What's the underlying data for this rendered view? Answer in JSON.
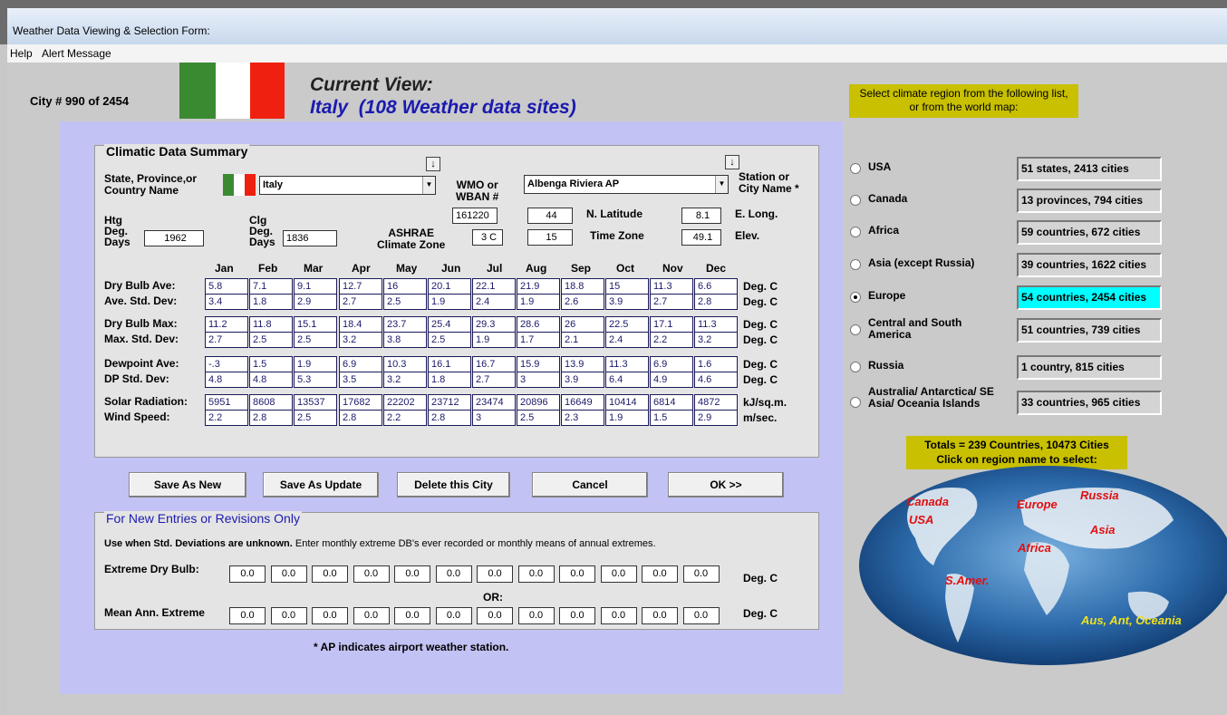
{
  "window": {
    "title": "Weather Data Viewing & Selection Form:"
  },
  "menu": {
    "help": "Help",
    "alert": "Alert Message"
  },
  "header": {
    "city_counter": "City # 990 of 2454",
    "current_view_label": "Current View:",
    "current_view_value": "Italy  (108 Weather data sites)"
  },
  "climatic": {
    "group_title": "Climatic Data Summary",
    "state_label_1": "State, Province,or",
    "state_label_2": "Country Name",
    "country_value": "Italy",
    "wmo_label_1": "WMO or",
    "wmo_label_2": "WBAN #",
    "station_value": "Albenga Riviera AP",
    "station_label_1": "Station or",
    "station_label_2": "City Name *",
    "wmo_value": "161220",
    "latitude_value": "44",
    "latitude_label": "N. Latitude",
    "longitude_value": "8.1",
    "longitude_label": "E. Long.",
    "htg_label_1": "Htg",
    "htg_label_2": "Deg.",
    "htg_label_3": "Days",
    "htg_value": "1962",
    "clg_label_1": "Clg",
    "clg_label_2": "Deg.",
    "clg_label_3": "Days",
    "clg_value": "1836",
    "ashrae_label_1": "ASHRAE",
    "ashrae_label_2": "Climate Zone",
    "ashrae_value": "3 C",
    "timezone_value": "15",
    "timezone_label": "Time Zone",
    "elev_value": "49.1",
    "elev_label": "Elev."
  },
  "months": [
    "Jan",
    "Feb",
    "Mar",
    "Apr",
    "May",
    "Jun",
    "Jul",
    "Aug",
    "Sep",
    "Oct",
    "Nov",
    "Dec"
  ],
  "rows": [
    {
      "label": "Dry Bulb Ave:",
      "unit": "Deg. C",
      "values": [
        "5.8",
        "7.1",
        "9.1",
        "12.7",
        "16",
        "20.1",
        "22.1",
        "21.9",
        "18.8",
        "15",
        "11.3",
        "6.6"
      ]
    },
    {
      "label": "Ave. Std. Dev:",
      "unit": "Deg. C",
      "values": [
        "3.4",
        "1.8",
        "2.9",
        "2.7",
        "2.5",
        "1.9",
        "2.4",
        "1.9",
        "2.6",
        "3.9",
        "2.7",
        "2.8"
      ]
    },
    {
      "label": "Dry Bulb Max:",
      "unit": "Deg. C",
      "values": [
        "11.2",
        "11.8",
        "15.1",
        "18.4",
        "23.7",
        "25.4",
        "29.3",
        "28.6",
        "26",
        "22.5",
        "17.1",
        "11.3"
      ]
    },
    {
      "label": "Max. Std. Dev:",
      "unit": "Deg. C",
      "values": [
        "2.7",
        "2.5",
        "2.5",
        "3.2",
        "3.8",
        "2.5",
        "1.9",
        "1.7",
        "2.1",
        "2.4",
        "2.2",
        "3.2"
      ]
    },
    {
      "label": "Dewpoint Ave:",
      "unit": "Deg. C",
      "values": [
        "-.3",
        "1.5",
        "1.9",
        "6.9",
        "10.3",
        "16.1",
        "16.7",
        "15.9",
        "13.9",
        "11.3",
        "6.9",
        "1.6"
      ]
    },
    {
      "label": "DP Std. Dev:",
      "unit": "Deg. C",
      "values": [
        "4.8",
        "4.8",
        "5.3",
        "3.5",
        "3.2",
        "1.8",
        "2.7",
        "3",
        "3.9",
        "6.4",
        "4.9",
        "4.6"
      ]
    },
    {
      "label": "Solar Radiation:",
      "unit": "kJ/sq.m.",
      "values": [
        "5951",
        "8608",
        "13537",
        "17682",
        "22202",
        "23712",
        "23474",
        "20896",
        "16649",
        "10414",
        "6814",
        "4872"
      ]
    },
    {
      "label": "Wind Speed:",
      "unit": "m/sec.",
      "values": [
        "2.2",
        "2.8",
        "2.5",
        "2.8",
        "2.2",
        "2.8",
        "3",
        "2.5",
        "2.3",
        "1.9",
        "1.5",
        "2.9"
      ]
    }
  ],
  "buttons": {
    "save_new": "Save As New",
    "save_update": "Save As Update",
    "delete": "Delete this City",
    "cancel": "Cancel",
    "ok": "OK >>"
  },
  "revisions": {
    "group_title": "For New Entries or Revisions Only",
    "instruction_bold": "Use when Std. Deviations are unknown.",
    "instruction_rest": " Enter monthly extreme DB's ever recorded or monthly means of annual extremes.",
    "extreme_label": "Extreme Dry Bulb:",
    "extreme_values": [
      "0.0",
      "0.0",
      "0.0",
      "0.0",
      "0.0",
      "0.0",
      "0.0",
      "0.0",
      "0.0",
      "0.0",
      "0.0",
      "0.0"
    ],
    "extreme_unit": "Deg. C",
    "or_label": "OR:",
    "mean_label": "Mean Ann. Extreme",
    "mean_values": [
      "0.0",
      "0.0",
      "0.0",
      "0.0",
      "0.0",
      "0.0",
      "0.0",
      "0.0",
      "0.0",
      "0.0",
      "0.0",
      "0.0"
    ],
    "mean_unit": "Deg. C"
  },
  "footnote": "* AP indicates airport weather station.",
  "regions": {
    "prompt_1": "Select climate region from the following list,",
    "prompt_2": "or from the world map:",
    "selected": "Europe",
    "items": [
      {
        "name": "USA",
        "count": "51 states, 2413 cities"
      },
      {
        "name": "Canada",
        "count": "13 provinces, 794 cities"
      },
      {
        "name": "Africa",
        "count": "59 countries, 672 cities"
      },
      {
        "name": "Asia (except Russia)",
        "count": "39 countries, 1622 cities"
      },
      {
        "name": "Europe",
        "count": "54 countries, 2454 cities"
      },
      {
        "name": "Central and South America",
        "count": "51 countries, 739 cities"
      },
      {
        "name": "Russia",
        "count": "1 country, 815 cities"
      },
      {
        "name": "Australia/ Antarctica/ SE Asia/ Oceania Islands",
        "count": "33 countries, 965 cities"
      }
    ],
    "totals_1": "Totals = 239 Countries, 10473 Cities",
    "totals_2": "Click on region name to select:"
  },
  "map_labels": [
    "Canada",
    "USA",
    "Europe",
    "Russia",
    "Asia",
    "Africa",
    "S.Amer.",
    "Aus, Ant, Oceania"
  ],
  "colors": {
    "selected_region": "#00ffff",
    "highlight": "#c8c000",
    "map_label": "#e01010",
    "view_text": "#1a1ab0"
  }
}
